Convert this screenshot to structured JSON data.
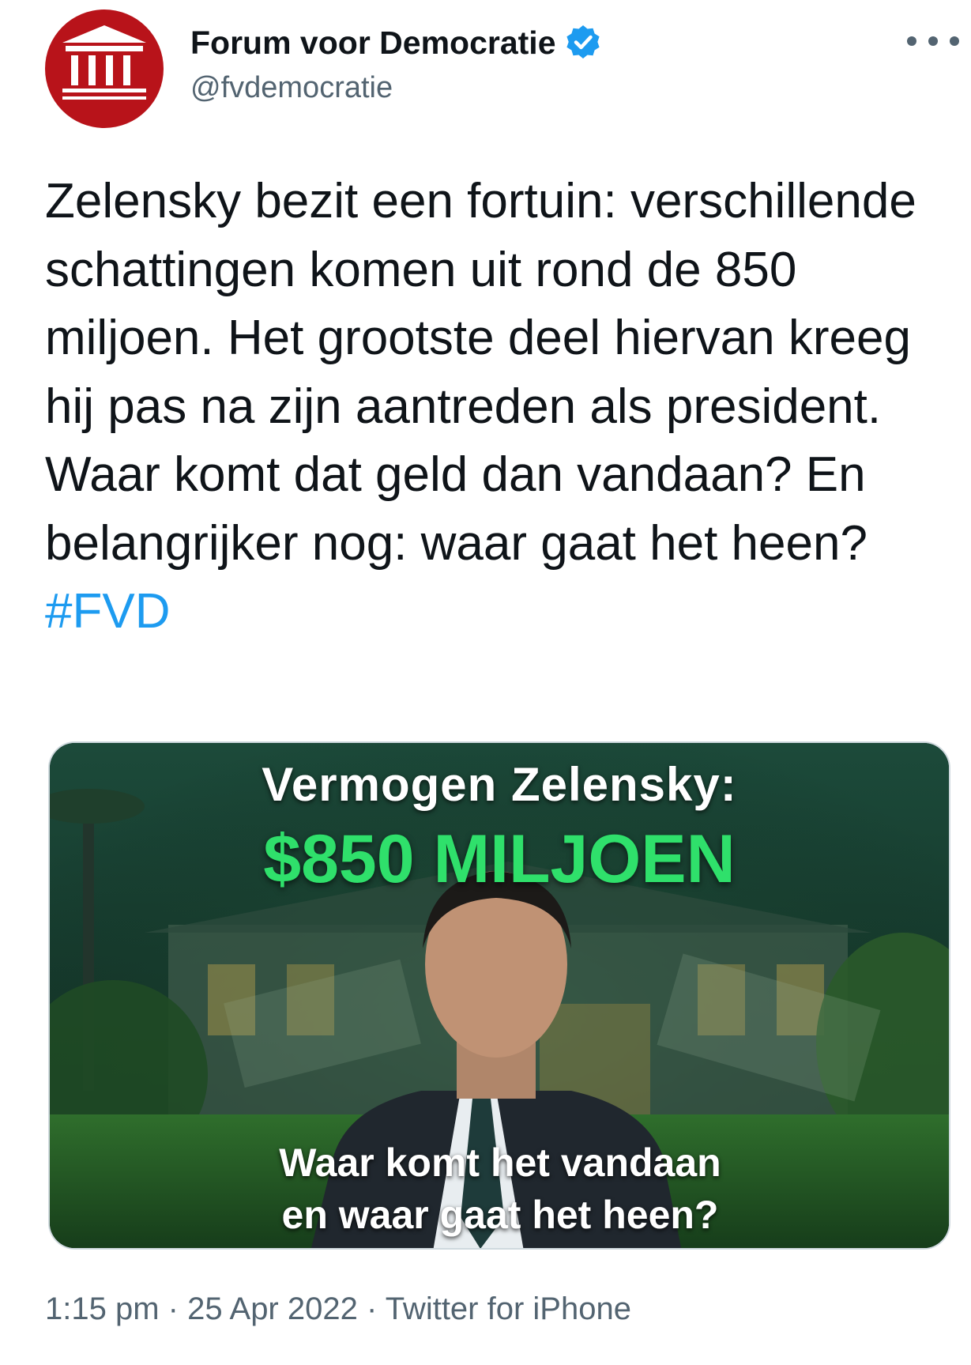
{
  "author": {
    "display_name": "Forum voor Democratie",
    "handle": "@fvdemocratie",
    "verified": true,
    "avatar_icon": "building-columns-icon",
    "avatar_color": "#b8131a"
  },
  "tweet": {
    "text": "Zelensky bezit een fortuin: verschillende schattingen komen uit rond de 850 miljoen. Het grootste deel hiervan kreeg hij pas na zijn aantreden als president. Waar komt dat geld dan vandaan? En belangrijker nog: waar gaat het heen?",
    "hashtag": "#FVD"
  },
  "media": {
    "headline": "Vermogen Zelensky:",
    "amount": "$850 MILJOEN",
    "question_line1": "Waar komt het vandaan",
    "question_line2": "en waar gaat het heen?"
  },
  "meta": {
    "time": "1:15 pm",
    "separator": "·",
    "date": "25 Apr 2022",
    "source": "Twitter for iPhone"
  },
  "colors": {
    "link": "#1d9bf0",
    "secondary_text": "#536471",
    "amount_green": "#2fe06b"
  }
}
